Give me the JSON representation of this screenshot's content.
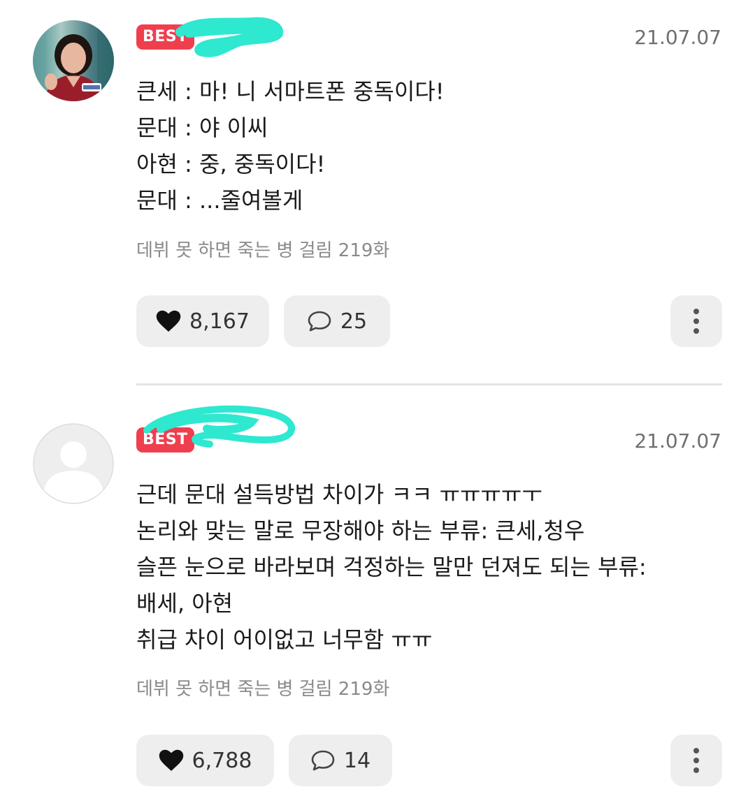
{
  "comments": [
    {
      "badge": "BEST",
      "date": "21.07.07",
      "lines": [
        "큰세 : 마! 니 서마트폰 중독이다!",
        "문대 : 야 이씨",
        "아현 : 중, 중독이다!",
        "문대 : ...줄여볼게"
      ],
      "episode": "데뷔 못 하면 죽는 병 걸림 219화",
      "likes": "8,167",
      "replies": "25",
      "avatar_type": "profile-photo"
    },
    {
      "badge": "BEST",
      "date": "21.07.07",
      "lines": [
        "근데 문대 설득방법 차이가 ㅋㅋ ㅠㅠㅠㅠㅜ",
        "논리와 맞는 말로 무장해야 하는 부류: 큰세,청우",
        "슬픈 눈으로 바라보며 걱정하는 말만 던져도 되는 부류:",
        "배세, 아현",
        "취급 차이 어이없고 너무함 ㅠㅠ"
      ],
      "episode": "데뷔 못 하면 죽는 병 걸림 219화",
      "likes": "6,788",
      "replies": "14",
      "avatar_type": "default-placeholder"
    }
  ],
  "icons": {
    "like": "heart-icon",
    "reply": "speech-bubble-icon",
    "more": "vertical-dots-icon"
  },
  "colors": {
    "badge": "#ef3f4f",
    "redaction": "#2ee8d0",
    "button_bg": "#eeeeee",
    "meta_text": "#8a8a8a"
  }
}
